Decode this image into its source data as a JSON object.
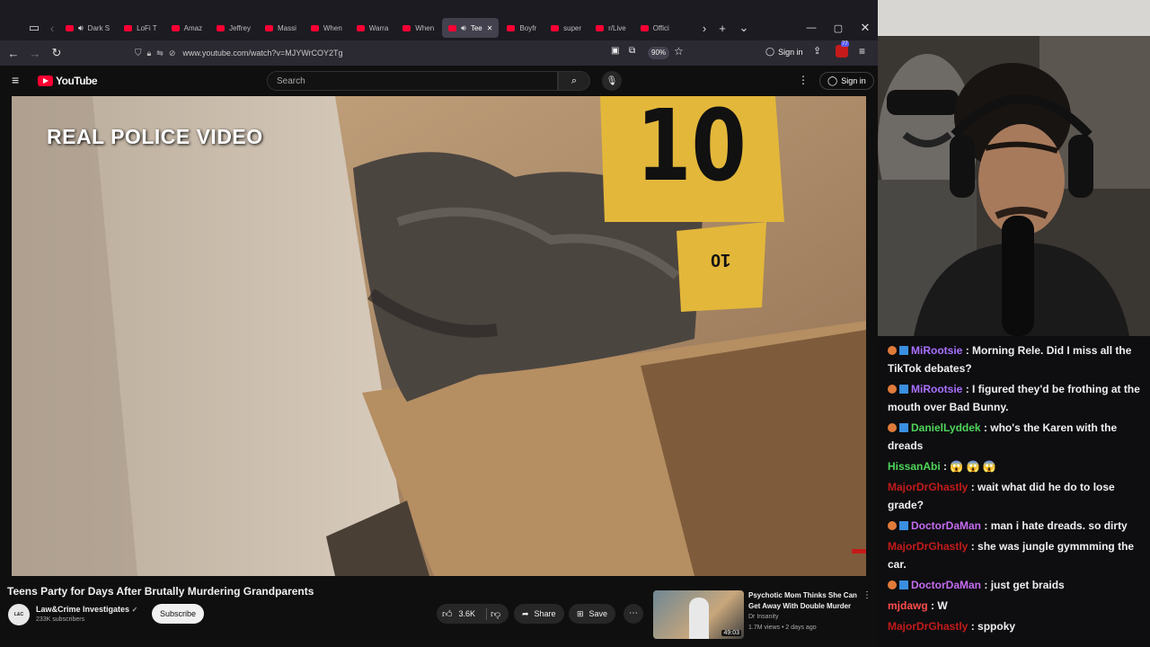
{
  "browser": {
    "tabs": [
      {
        "label": "Dark S",
        "audio": true
      },
      {
        "label": "LoFi T"
      },
      {
        "label": "Amaz"
      },
      {
        "label": "Jeffrey"
      },
      {
        "label": "Massi"
      },
      {
        "label": "When"
      },
      {
        "label": "Warra"
      },
      {
        "label": "When"
      },
      {
        "label": "Tee",
        "active": true,
        "audio": true
      },
      {
        "label": "Boyfr"
      },
      {
        "label": "super"
      },
      {
        "label": "r/Live"
      },
      {
        "label": "Offici"
      }
    ],
    "url": "www.youtube.com/watch?v=MJYWrCOY2Tg",
    "zoom": "90%",
    "sign_in_label": "Sign in",
    "ext_badge": "77"
  },
  "youtube": {
    "logo": "YouTube",
    "search_placeholder": "Search",
    "sign_in_label": "Sign in",
    "video_overlay": "REAL POLICE VIDEO",
    "marker_number": "10",
    "marker_small": "10",
    "title": "Teens Party for Days After Brutally Murdering Grandparents",
    "channel": "Law&Crime Investigates",
    "subscribers": "233K subscribers",
    "subscribe_label": "Subscribe",
    "likes": "3.6K",
    "share_label": "Share",
    "save_label": "Save",
    "recommended": {
      "title_line1": "Psychotic Mom Thinks She Can",
      "title_line2": "Get Away With Double Murder",
      "channel": "Dr Insanity",
      "stats": "1.7M views • 2 days ago",
      "duration": "49:03"
    }
  },
  "chat": {
    "messages": [
      {
        "user": "MiRootsie",
        "color": "#a970ff",
        "text": ": Morning Rele. Did I miss all the TikTok debates?",
        "badges": true
      },
      {
        "user": "MiRootsie",
        "color": "#a970ff",
        "text": ": I figured they'd be frothing at the mouth over Bad Bunny.",
        "badges": true
      },
      {
        "user": "DanielLyddek",
        "color": "#4fd45a",
        "text": ": who's the Karen with the dreads",
        "badges": true
      },
      {
        "user": "HissanAbi",
        "color": "#4fd45a",
        "text": ": 😱 😱 😱"
      },
      {
        "user": "MajorDrGhastly",
        "color": "#c41a1a",
        "text": ": wait what did he do to lose grade?"
      },
      {
        "user": "DoctorDaMan",
        "color": "#c56cf0",
        "text": ": man i hate dreads. so dirty",
        "badges": true
      },
      {
        "user": "MajorDrGhastly",
        "color": "#c41a1a",
        "text": ": she was jungle gymmming the car."
      },
      {
        "user": "DoctorDaMan",
        "color": "#c56cf0",
        "text": ": just get braids",
        "badges": true
      },
      {
        "user": "mjdawg",
        "color": "#ff4d4d",
        "text": ": W"
      },
      {
        "user": "MajorDrGhastly",
        "color": "#c41a1a",
        "text": ": sppoky"
      }
    ]
  },
  "colors": {
    "yt_red": "#ff0033",
    "chrome_dark": "#1c1b22",
    "chat_bg": "#0e0e10"
  }
}
